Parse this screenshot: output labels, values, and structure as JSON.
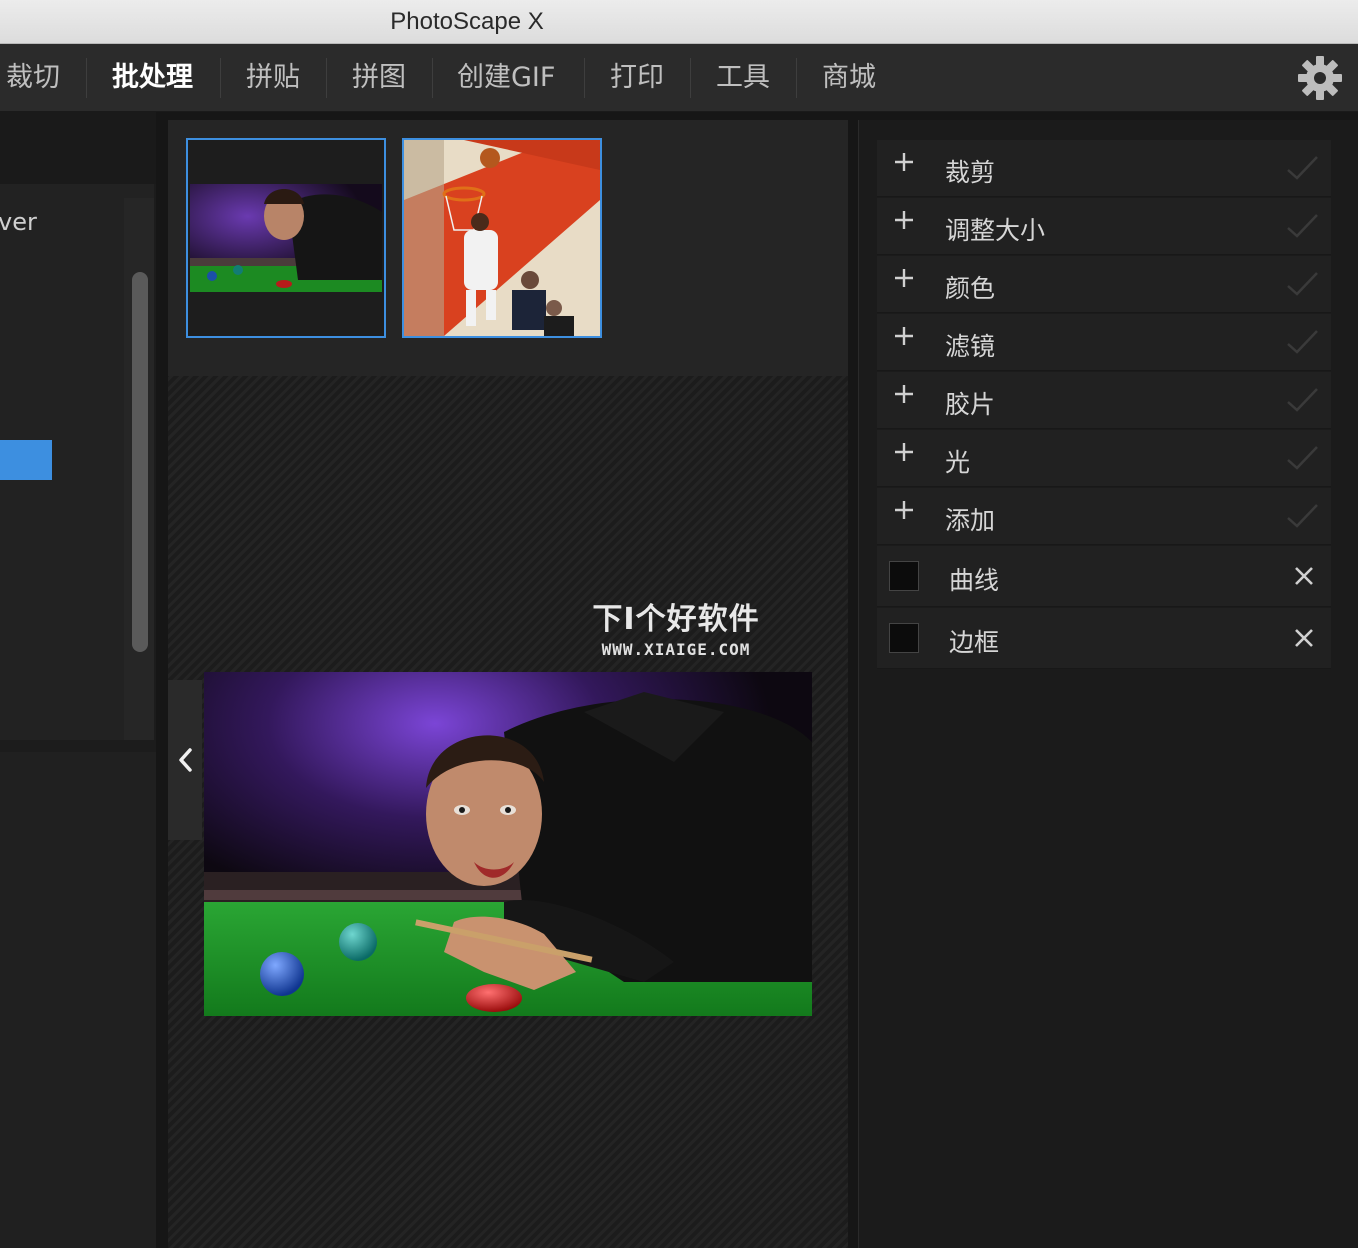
{
  "window": {
    "title": "PhotoScape X"
  },
  "menu": {
    "items": [
      {
        "label": "裁切",
        "active": false
      },
      {
        "label": "批处理",
        "active": true
      },
      {
        "label": "拼贴",
        "active": false
      },
      {
        "label": "拼图",
        "active": false
      },
      {
        "label": "创建GIF",
        "active": false
      },
      {
        "label": "打印",
        "active": false
      },
      {
        "label": "工具",
        "active": false
      },
      {
        "label": "商城",
        "active": false
      }
    ],
    "settings_icon": "gear-icon"
  },
  "left_panel": {
    "partial_text": "ver",
    "accent": "#3d8fe0"
  },
  "thumbnails": [
    {
      "subject": "snooker-photo"
    },
    {
      "subject": "basketball-photo"
    }
  ],
  "watermark": {
    "title": "下I个好软件",
    "url": "WWW.XIAIGE.COM"
  },
  "right_panel": {
    "add_items": [
      {
        "label": "裁剪"
      },
      {
        "label": "调整大小"
      },
      {
        "label": "颜色"
      },
      {
        "label": "滤镜"
      },
      {
        "label": "胶片"
      },
      {
        "label": "光"
      },
      {
        "label": "添加"
      }
    ],
    "toggle_items": [
      {
        "label": "曲线"
      },
      {
        "label": "边框"
      }
    ]
  },
  "colors": {
    "accent": "#3d8fe0",
    "panel": "#212121",
    "background": "#161616"
  }
}
